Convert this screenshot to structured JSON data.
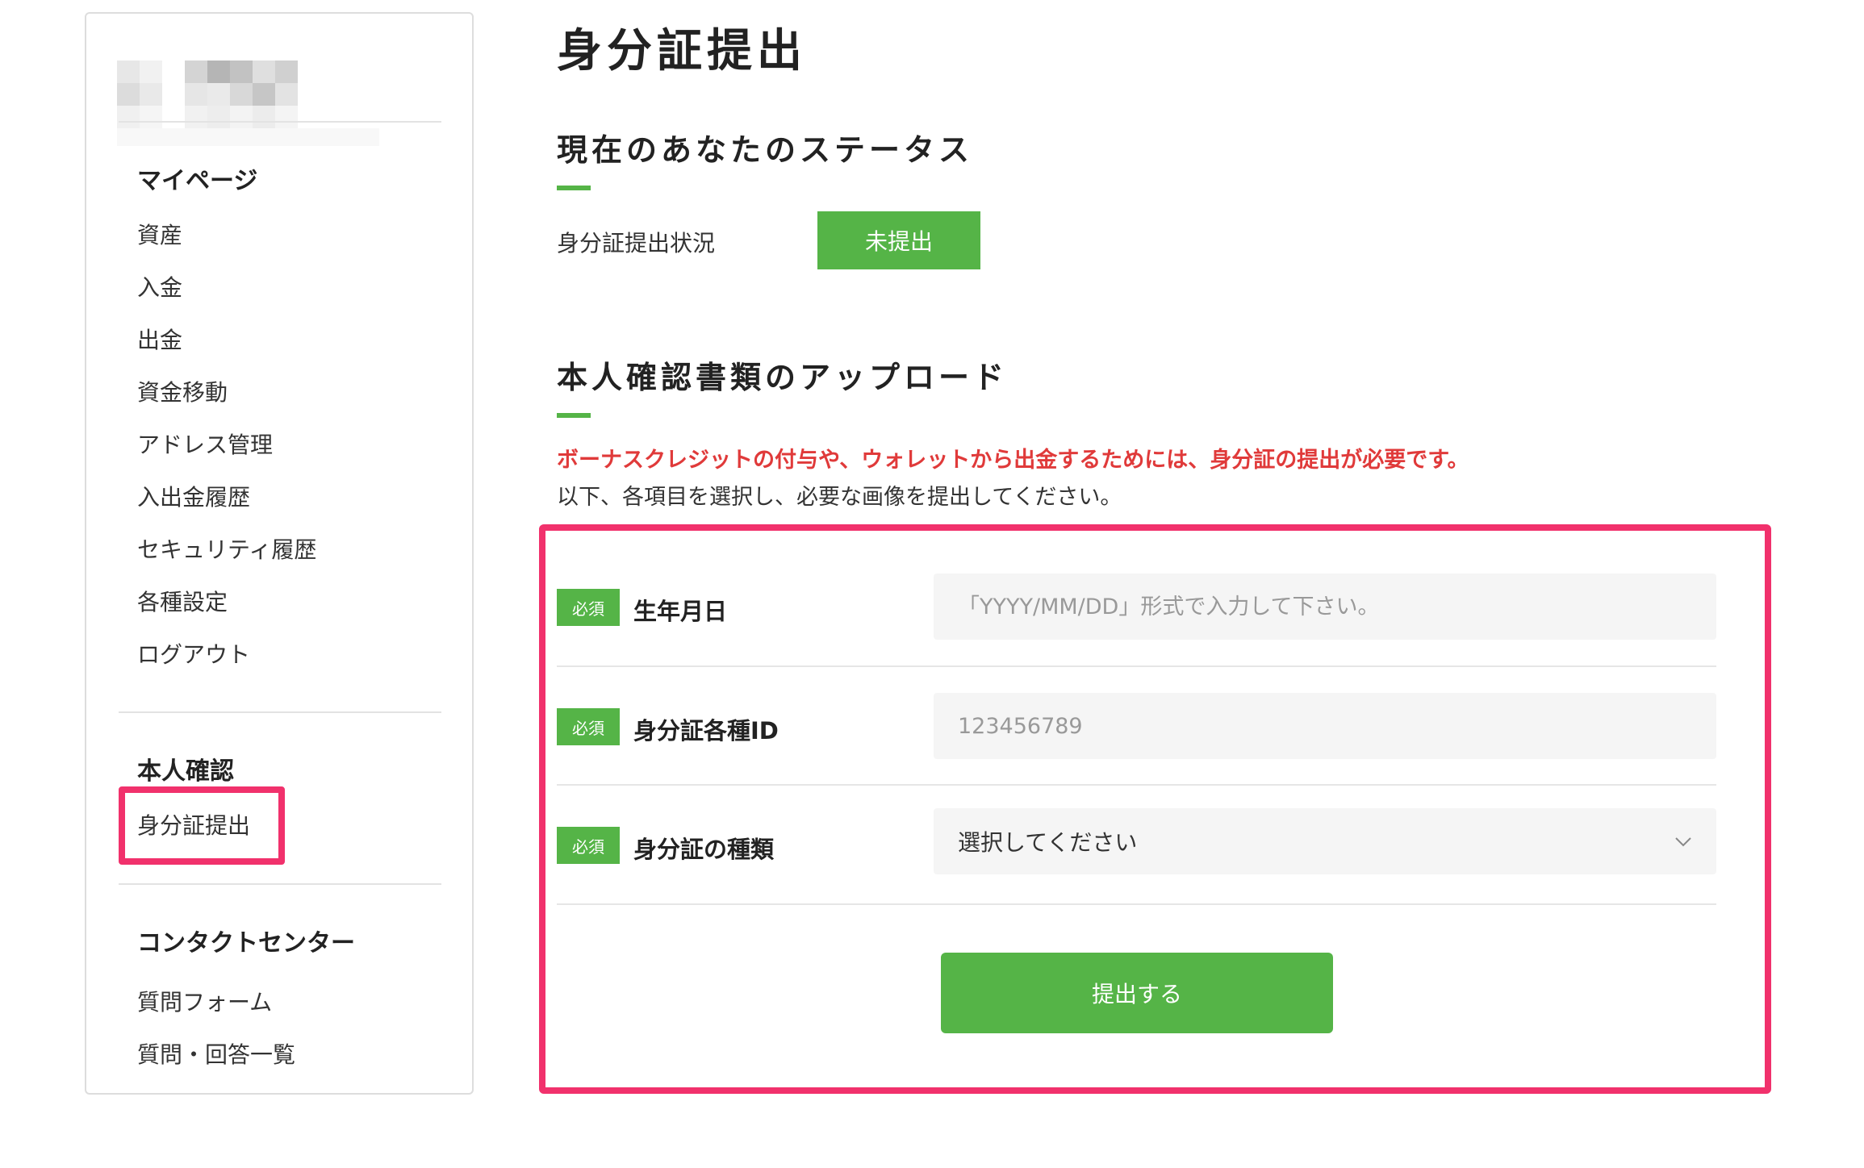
{
  "page": {
    "title": "身分証提出"
  },
  "sidebar": {
    "mypage_heading": "マイページ",
    "mypage_items": [
      "資産",
      "入金",
      "出金",
      "資金移動",
      "アドレス管理",
      "入出金履歴",
      "セキュリティ履歴",
      "各種設定",
      "ログアウト"
    ],
    "kyc_heading": "本人確認",
    "kyc_items": [
      "身分証提出"
    ],
    "contact_heading": "コンタクトセンター",
    "contact_items": [
      "質問フォーム",
      "質問・回答一覧"
    ]
  },
  "status": {
    "heading": "現在のあなたのステータス",
    "label": "身分証提出状況",
    "badge": "未提出"
  },
  "upload": {
    "heading": "本人確認書類のアップロード",
    "notice_red": "ボーナスクレジットの付与や、ウォレットから出金するためには、身分証の提出が必要です。",
    "notice": "以下、各項目を選択し、必要な画像を提出してください。",
    "required_label": "必須",
    "fields": {
      "birthdate": {
        "label": "生年月日",
        "placeholder": "「YYYY/MM/DD」形式で入力して下さい。"
      },
      "id_number": {
        "label": "身分証各種ID",
        "placeholder": "123456789"
      },
      "id_type": {
        "label": "身分証の種類",
        "selected": "選択してください"
      }
    },
    "submit_label": "提出する"
  },
  "colors": {
    "accent": "#55b447",
    "highlight": "#f1316c",
    "warning": "#e03a3a"
  }
}
